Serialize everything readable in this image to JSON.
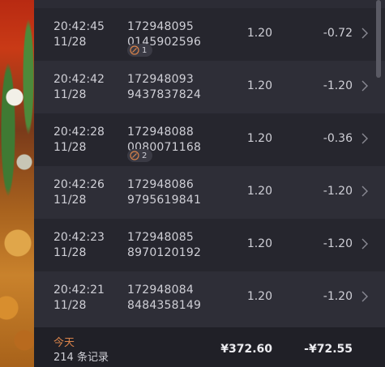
{
  "rows": [
    {
      "time": "20:42:45",
      "date": "11/28",
      "order_line1": "172948095",
      "order_line2": "0145902596",
      "price": "1.20",
      "amount": "-0.72",
      "badge": "1"
    },
    {
      "time": "20:42:42",
      "date": "11/28",
      "order_line1": "172948093",
      "order_line2": "9437837824",
      "price": "1.20",
      "amount": "-1.20"
    },
    {
      "time": "20:42:28",
      "date": "11/28",
      "order_line1": "172948088",
      "order_line2": "0080071168",
      "price": "1.20",
      "amount": "-0.36",
      "badge": "2"
    },
    {
      "time": "20:42:26",
      "date": "11/28",
      "order_line1": "172948086",
      "order_line2": "9795619841",
      "price": "1.20",
      "amount": "-1.20"
    },
    {
      "time": "20:42:23",
      "date": "11/28",
      "order_line1": "172948085",
      "order_line2": "8970120192",
      "price": "1.20",
      "amount": "-1.20"
    },
    {
      "time": "20:42:21",
      "date": "11/28",
      "order_line1": "172948084",
      "order_line2": "8484358149",
      "price": "1.20",
      "amount": "-1.20"
    }
  ],
  "footer": {
    "today_label": "今天",
    "count_label": "214 条记录",
    "total_price": "¥372.60",
    "total_amount": "-¥72.55"
  },
  "colors": {
    "panel_bg": "#26262e",
    "row_alt_bg": "#2e2e37",
    "today_accent": "#d9834a",
    "text": "#cfcfd6"
  },
  "icons": {
    "row_chevron": "chevron-right-icon",
    "badge_icon": "discount-tag-icon"
  }
}
